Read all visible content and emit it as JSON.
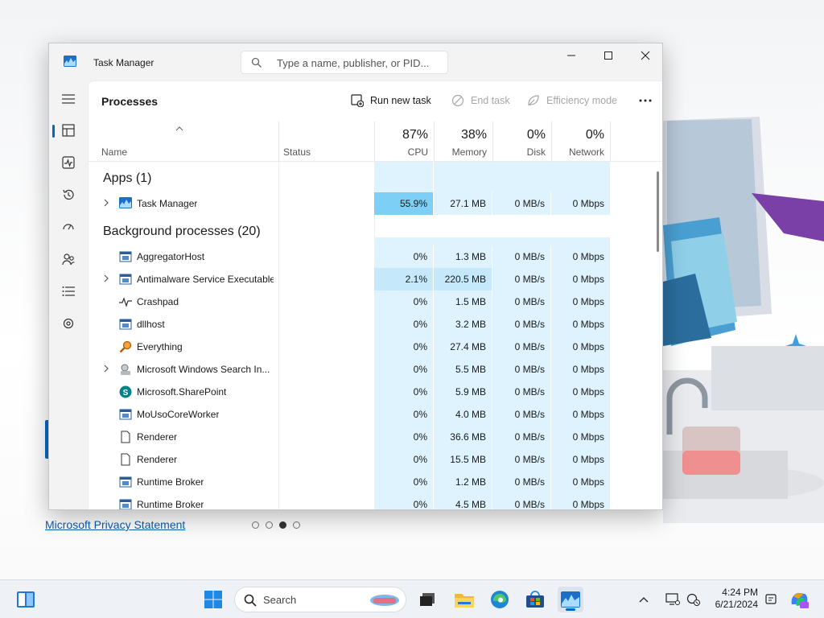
{
  "background": {
    "privacy_link": "Microsoft Privacy Statement",
    "carousel_dots": 4,
    "carousel_active": 3
  },
  "window": {
    "title": "Task Manager",
    "search_placeholder": "Type a name, publisher, or PID..."
  },
  "nav": {
    "items": [
      "menu-icon",
      "processes-icon",
      "performance-icon",
      "app-history-icon",
      "startup-apps-icon",
      "users-icon",
      "details-icon",
      "services-icon"
    ],
    "settings": "settings-icon"
  },
  "commandbar": {
    "page_title": "Processes",
    "run_new_task": "Run new task",
    "end_task": "End task",
    "efficiency_mode": "Efficiency mode"
  },
  "columns": {
    "name": "Name",
    "status": "Status",
    "cpu_pct": "87%",
    "cpu": "CPU",
    "memory_pct": "38%",
    "memory": "Memory",
    "disk_pct": "0%",
    "disk": "Disk",
    "network_pct": "0%",
    "network": "Network"
  },
  "groups": {
    "apps": "Apps (1)",
    "background": "Background processes (20)"
  },
  "apps": [
    {
      "name": "Task Manager",
      "cpu": "55.9%",
      "memory": "27.1 MB",
      "disk": "0 MB/s",
      "network": "0 Mbps",
      "expandable": true
    }
  ],
  "background_processes": [
    {
      "name": "AggregatorHost",
      "cpu": "0%",
      "memory": "1.3 MB",
      "disk": "0 MB/s",
      "network": "0 Mbps"
    },
    {
      "name": "Antimalware Service Executable",
      "cpu": "2.1%",
      "memory": "220.5 MB",
      "disk": "0 MB/s",
      "network": "0 Mbps",
      "expandable": true
    },
    {
      "name": "Crashpad",
      "cpu": "0%",
      "memory": "1.5 MB",
      "disk": "0 MB/s",
      "network": "0 Mbps"
    },
    {
      "name": "dllhost",
      "cpu": "0%",
      "memory": "3.2 MB",
      "disk": "0 MB/s",
      "network": "0 Mbps"
    },
    {
      "name": "Everything",
      "cpu": "0%",
      "memory": "27.4 MB",
      "disk": "0 MB/s",
      "network": "0 Mbps"
    },
    {
      "name": "Microsoft Windows Search In...",
      "cpu": "0%",
      "memory": "5.5 MB",
      "disk": "0 MB/s",
      "network": "0 Mbps",
      "expandable": true
    },
    {
      "name": "Microsoft.SharePoint",
      "cpu": "0%",
      "memory": "5.9 MB",
      "disk": "0 MB/s",
      "network": "0 Mbps"
    },
    {
      "name": "MoUsoCoreWorker",
      "cpu": "0%",
      "memory": "4.0 MB",
      "disk": "0 MB/s",
      "network": "0 Mbps"
    },
    {
      "name": "Renderer",
      "cpu": "0%",
      "memory": "36.6 MB",
      "disk": "0 MB/s",
      "network": "0 Mbps"
    },
    {
      "name": "Renderer",
      "cpu": "0%",
      "memory": "15.5 MB",
      "disk": "0 MB/s",
      "network": "0 Mbps"
    },
    {
      "name": "Runtime Broker",
      "cpu": "0%",
      "memory": "1.2 MB",
      "disk": "0 MB/s",
      "network": "0 Mbps"
    },
    {
      "name": "Runtime Broker",
      "cpu": "0%",
      "memory": "4.5 MB",
      "disk": "0 MB/s",
      "network": "0 Mbps"
    }
  ],
  "taskbar": {
    "search_label": "Search",
    "time": "4:24 PM",
    "date": "6/21/2024"
  },
  "colors": {
    "accent": "#0067c0",
    "heat_low": "#def3fd",
    "heat_mid": "#c5e9fb",
    "heat_high": "#7dcff5"
  }
}
